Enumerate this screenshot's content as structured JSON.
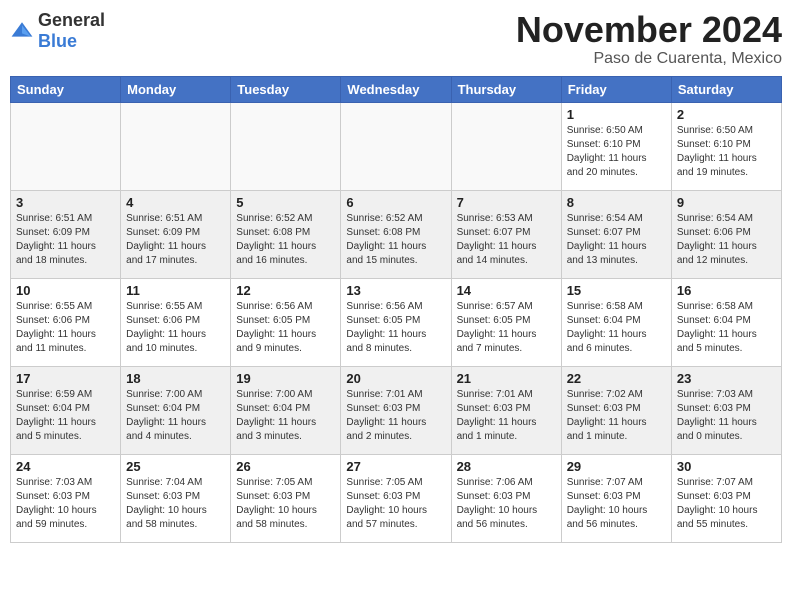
{
  "header": {
    "logo_general": "General",
    "logo_blue": "Blue",
    "month_title": "November 2024",
    "location": "Paso de Cuarenta, Mexico"
  },
  "weekdays": [
    "Sunday",
    "Monday",
    "Tuesday",
    "Wednesday",
    "Thursday",
    "Friday",
    "Saturday"
  ],
  "weeks": [
    [
      {
        "day": "",
        "info": ""
      },
      {
        "day": "",
        "info": ""
      },
      {
        "day": "",
        "info": ""
      },
      {
        "day": "",
        "info": ""
      },
      {
        "day": "",
        "info": ""
      },
      {
        "day": "1",
        "info": "Sunrise: 6:50 AM\nSunset: 6:10 PM\nDaylight: 11 hours and 20 minutes."
      },
      {
        "day": "2",
        "info": "Sunrise: 6:50 AM\nSunset: 6:10 PM\nDaylight: 11 hours and 19 minutes."
      }
    ],
    [
      {
        "day": "3",
        "info": "Sunrise: 6:51 AM\nSunset: 6:09 PM\nDaylight: 11 hours and 18 minutes."
      },
      {
        "day": "4",
        "info": "Sunrise: 6:51 AM\nSunset: 6:09 PM\nDaylight: 11 hours and 17 minutes."
      },
      {
        "day": "5",
        "info": "Sunrise: 6:52 AM\nSunset: 6:08 PM\nDaylight: 11 hours and 16 minutes."
      },
      {
        "day": "6",
        "info": "Sunrise: 6:52 AM\nSunset: 6:08 PM\nDaylight: 11 hours and 15 minutes."
      },
      {
        "day": "7",
        "info": "Sunrise: 6:53 AM\nSunset: 6:07 PM\nDaylight: 11 hours and 14 minutes."
      },
      {
        "day": "8",
        "info": "Sunrise: 6:54 AM\nSunset: 6:07 PM\nDaylight: 11 hours and 13 minutes."
      },
      {
        "day": "9",
        "info": "Sunrise: 6:54 AM\nSunset: 6:06 PM\nDaylight: 11 hours and 12 minutes."
      }
    ],
    [
      {
        "day": "10",
        "info": "Sunrise: 6:55 AM\nSunset: 6:06 PM\nDaylight: 11 hours and 11 minutes."
      },
      {
        "day": "11",
        "info": "Sunrise: 6:55 AM\nSunset: 6:06 PM\nDaylight: 11 hours and 10 minutes."
      },
      {
        "day": "12",
        "info": "Sunrise: 6:56 AM\nSunset: 6:05 PM\nDaylight: 11 hours and 9 minutes."
      },
      {
        "day": "13",
        "info": "Sunrise: 6:56 AM\nSunset: 6:05 PM\nDaylight: 11 hours and 8 minutes."
      },
      {
        "day": "14",
        "info": "Sunrise: 6:57 AM\nSunset: 6:05 PM\nDaylight: 11 hours and 7 minutes."
      },
      {
        "day": "15",
        "info": "Sunrise: 6:58 AM\nSunset: 6:04 PM\nDaylight: 11 hours and 6 minutes."
      },
      {
        "day": "16",
        "info": "Sunrise: 6:58 AM\nSunset: 6:04 PM\nDaylight: 11 hours and 5 minutes."
      }
    ],
    [
      {
        "day": "17",
        "info": "Sunrise: 6:59 AM\nSunset: 6:04 PM\nDaylight: 11 hours and 5 minutes."
      },
      {
        "day": "18",
        "info": "Sunrise: 7:00 AM\nSunset: 6:04 PM\nDaylight: 11 hours and 4 minutes."
      },
      {
        "day": "19",
        "info": "Sunrise: 7:00 AM\nSunset: 6:04 PM\nDaylight: 11 hours and 3 minutes."
      },
      {
        "day": "20",
        "info": "Sunrise: 7:01 AM\nSunset: 6:03 PM\nDaylight: 11 hours and 2 minutes."
      },
      {
        "day": "21",
        "info": "Sunrise: 7:01 AM\nSunset: 6:03 PM\nDaylight: 11 hours and 1 minute."
      },
      {
        "day": "22",
        "info": "Sunrise: 7:02 AM\nSunset: 6:03 PM\nDaylight: 11 hours and 1 minute."
      },
      {
        "day": "23",
        "info": "Sunrise: 7:03 AM\nSunset: 6:03 PM\nDaylight: 11 hours and 0 minutes."
      }
    ],
    [
      {
        "day": "24",
        "info": "Sunrise: 7:03 AM\nSunset: 6:03 PM\nDaylight: 10 hours and 59 minutes."
      },
      {
        "day": "25",
        "info": "Sunrise: 7:04 AM\nSunset: 6:03 PM\nDaylight: 10 hours and 58 minutes."
      },
      {
        "day": "26",
        "info": "Sunrise: 7:05 AM\nSunset: 6:03 PM\nDaylight: 10 hours and 58 minutes."
      },
      {
        "day": "27",
        "info": "Sunrise: 7:05 AM\nSunset: 6:03 PM\nDaylight: 10 hours and 57 minutes."
      },
      {
        "day": "28",
        "info": "Sunrise: 7:06 AM\nSunset: 6:03 PM\nDaylight: 10 hours and 56 minutes."
      },
      {
        "day": "29",
        "info": "Sunrise: 7:07 AM\nSunset: 6:03 PM\nDaylight: 10 hours and 56 minutes."
      },
      {
        "day": "30",
        "info": "Sunrise: 7:07 AM\nSunset: 6:03 PM\nDaylight: 10 hours and 55 minutes."
      }
    ]
  ]
}
